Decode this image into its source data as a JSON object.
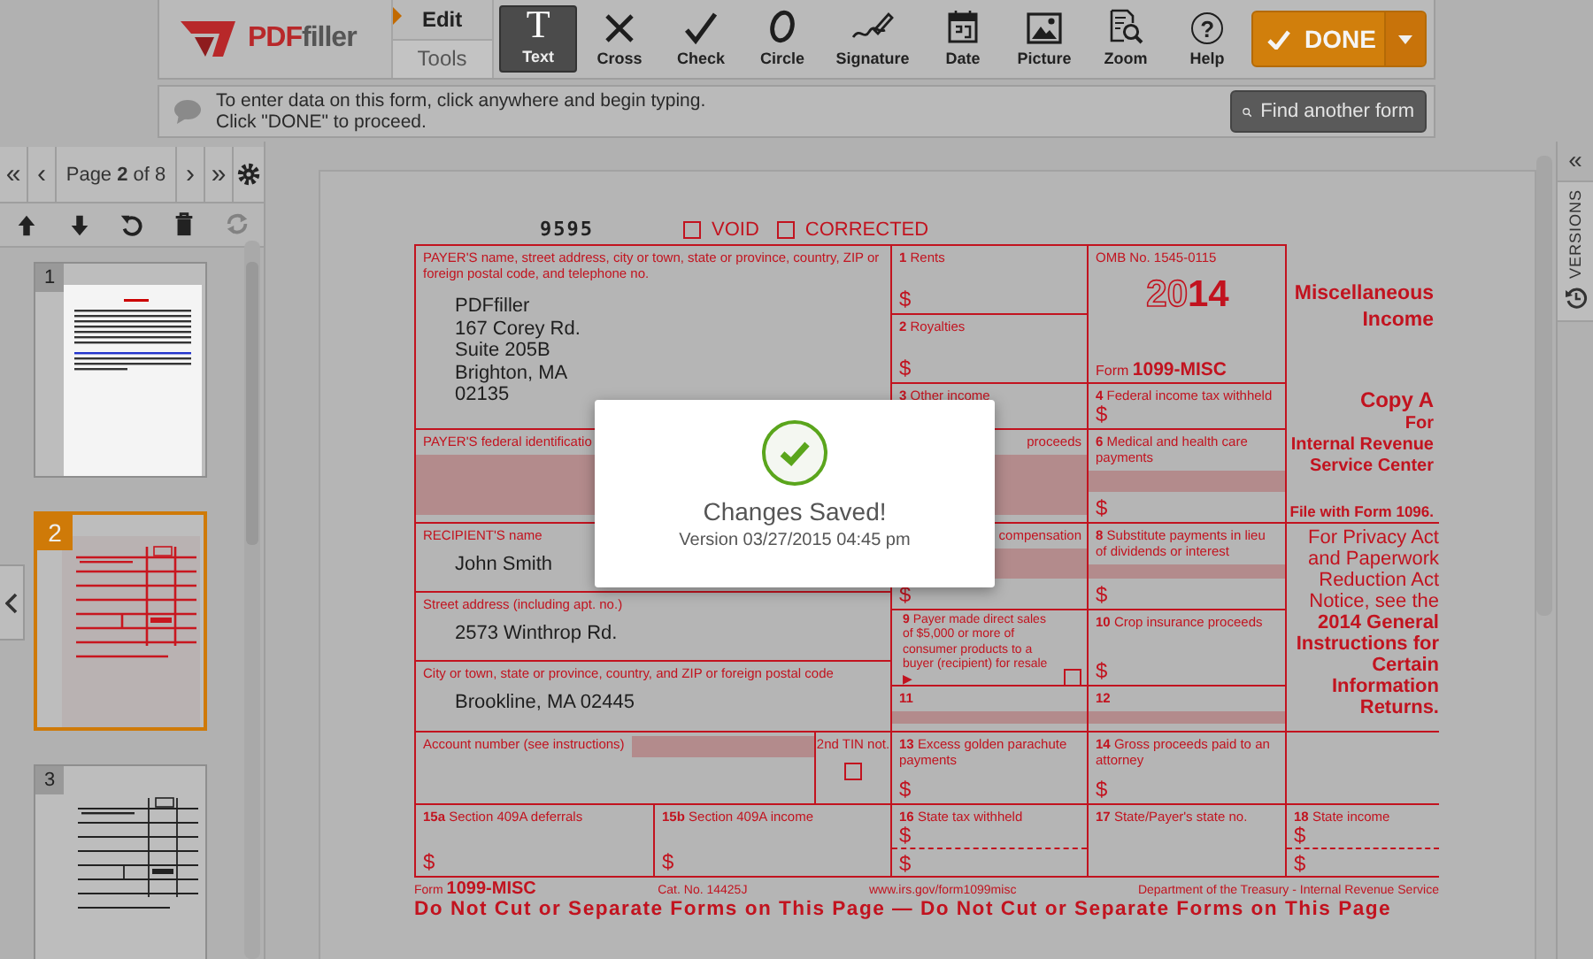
{
  "toolbar": {
    "logo": {
      "prefix": "PDF",
      "suffix": "filler"
    },
    "tabs": [
      {
        "label": "Edit",
        "selected": true
      },
      {
        "label": "Tools",
        "selected": false
      }
    ],
    "tools": [
      {
        "label": "Text",
        "kind": "text",
        "glyph": "T",
        "selected": true
      },
      {
        "label": "Cross",
        "kind": "cross",
        "selected": false
      },
      {
        "label": "Check",
        "kind": "check",
        "selected": false
      },
      {
        "label": "Circle",
        "kind": "circle",
        "selected": false
      },
      {
        "label": "Signature",
        "kind": "signature",
        "selected": false
      },
      {
        "label": "Date",
        "kind": "date",
        "selected": false
      },
      {
        "label": "Picture",
        "kind": "picture",
        "selected": false
      },
      {
        "label": "Zoom",
        "kind": "zoom",
        "selected": false
      },
      {
        "label": "Help",
        "kind": "help",
        "glyph": "?",
        "selected": false
      }
    ],
    "done": {
      "label": "DONE"
    }
  },
  "info_bar": {
    "lines": [
      "To enter data on this form, click anywhere and begin typing.",
      "Click \"DONE\" to proceed."
    ],
    "button": "Find another form"
  },
  "pager": {
    "first": "«",
    "prev": "‹",
    "page": "Page **2** of 8",
    "next": "›",
    "last": "»"
  },
  "page_tools": [
    {
      "kind": "up",
      "disabled": false
    },
    {
      "kind": "down",
      "disabled": false
    },
    {
      "kind": "rotate",
      "disabled": false
    },
    {
      "kind": "delete",
      "disabled": false
    },
    {
      "kind": "refresh",
      "disabled": true
    }
  ],
  "thumbnails": [
    {
      "number": "1",
      "kind": "letter",
      "selected": false
    },
    {
      "number": "2",
      "kind": "red-form",
      "selected": true
    },
    {
      "number": "3",
      "kind": "black-form",
      "selected": false
    }
  ],
  "versions_panel": {
    "collapse": "«",
    "label": "VERSIONS"
  },
  "form": {
    "header": {
      "code": "9595",
      "checkboxes": [
        {
          "label": "VOID",
          "checked": false
        },
        {
          "label": "CORRECTED",
          "checked": false
        }
      ]
    },
    "cells": [
      {
        "kind": "box",
        "label": "PAYER'S name, street address, city or town, state or province, country, ZIP or foreign postal code, and telephone no.",
        "values": [
          "PDFfiller",
          "167 Corey Rd.",
          "Suite 205B",
          "Brighton, MA",
          "02135"
        ]
      },
      {
        "kind": "box",
        "number": "1",
        "label": "Rents",
        "dollars": [
          "$"
        ]
      },
      {
        "kind": "box",
        "number": "2",
        "label": "Royalties",
        "dollars": [
          "$"
        ]
      },
      {
        "kind": "omb",
        "label": "OMB No. 1545-0115",
        "year": "20**14**",
        "form": "Form **1099-MISC**"
      },
      {
        "kind": "title",
        "title": "Miscellaneous Income"
      },
      {
        "kind": "box",
        "number": "3",
        "label": "Other income"
      },
      {
        "kind": "box",
        "number": "4",
        "label": "Federal income tax withheld",
        "dollars": [
          "$"
        ]
      },
      {
        "kind": "copy",
        "lines": [
          "Copy A",
          "For",
          "Internal Revenue",
          "Service Center"
        ],
        "note": "File with Form 1096."
      },
      {
        "kind": "box",
        "label": "PAYER'S federal identificatio",
        "fill": true
      },
      {
        "kind": "box",
        "label": "proceeds",
        "partial": true,
        "fill": true
      },
      {
        "kind": "box",
        "number": "6",
        "label": "Medical and health care payments",
        "fill": true,
        "dollars": [
          "$"
        ]
      },
      {
        "kind": "box",
        "label": "RECIPIENT'S name",
        "values": [
          "John Smith"
        ]
      },
      {
        "kind": "box",
        "label": "compensation",
        "partial": true,
        "fill": true,
        "dollars": [
          "$"
        ]
      },
      {
        "kind": "box",
        "number": "8",
        "label": "Substitute payments in lieu of dividends or interest",
        "fill": true,
        "dollars": [
          "$"
        ]
      },
      {
        "kind": "box",
        "label": "Street address (including apt. no.)",
        "values": [
          "2573 Winthrop Rd."
        ]
      },
      {
        "kind": "box",
        "number": "9",
        "label": "Payer made direct sales of $5,000 or more of consumer products to a buyer (recipient) for resale ▶",
        "checkbox": {
          "checked": false
        }
      },
      {
        "kind": "box",
        "number": "10",
        "label": "Crop insurance proceeds",
        "dollars": [
          "$"
        ]
      },
      {
        "kind": "box",
        "label": "City or town, state or province, country, and ZIP or foreign postal code",
        "values": [
          "Brookline, MA 02445"
        ]
      },
      {
        "kind": "box",
        "number": "11",
        "fill": true
      },
      {
        "kind": "box",
        "number": "12",
        "fill": true
      },
      {
        "kind": "notice",
        "text": "For Privacy Act and Paperwork Reduction Act Notice, see the **2014 General Instructions for Certain Information Returns.**"
      },
      {
        "kind": "account",
        "label": "Account number (see instructions)",
        "fill": true,
        "tin": {
          "label": "2nd TIN not.",
          "checked": false
        }
      },
      {
        "kind": "box",
        "number": "13",
        "label": "Excess golden parachute payments",
        "dollars": [
          "$"
        ]
      },
      {
        "kind": "box",
        "number": "14",
        "label": "Gross proceeds paid to an attorney",
        "dollars": [
          "$"
        ]
      },
      {
        "kind": "blank"
      },
      {
        "kind": "box",
        "number": "15a",
        "label": "Section 409A deferrals",
        "dollars": [
          "$"
        ]
      },
      {
        "kind": "box",
        "number": "15b",
        "label": "Section 409A income",
        "dollars": [
          "$"
        ]
      },
      {
        "kind": "box",
        "number": "16",
        "label": "State tax withheld",
        "dollars": [
          "$",
          "$"
        ]
      },
      {
        "kind": "box",
        "number": "17",
        "label": "State/Payer's state no."
      },
      {
        "kind": "box",
        "number": "18",
        "label": "State income",
        "dollars": [
          "$",
          "$"
        ]
      }
    ],
    "footer": [
      "Form **1099-MISC**",
      "Cat. No. 14425J",
      "www.irs.gov/form1099misc",
      "Department of the Treasury - Internal Revenue Service"
    ],
    "banner": "Do Not Cut or Separate Forms on This Page — Do Not Cut or Separate Forms on This Page"
  },
  "dialog": {
    "title": "Changes Saved!",
    "subtitle": "Version 03/27/2015 04:45 pm"
  }
}
